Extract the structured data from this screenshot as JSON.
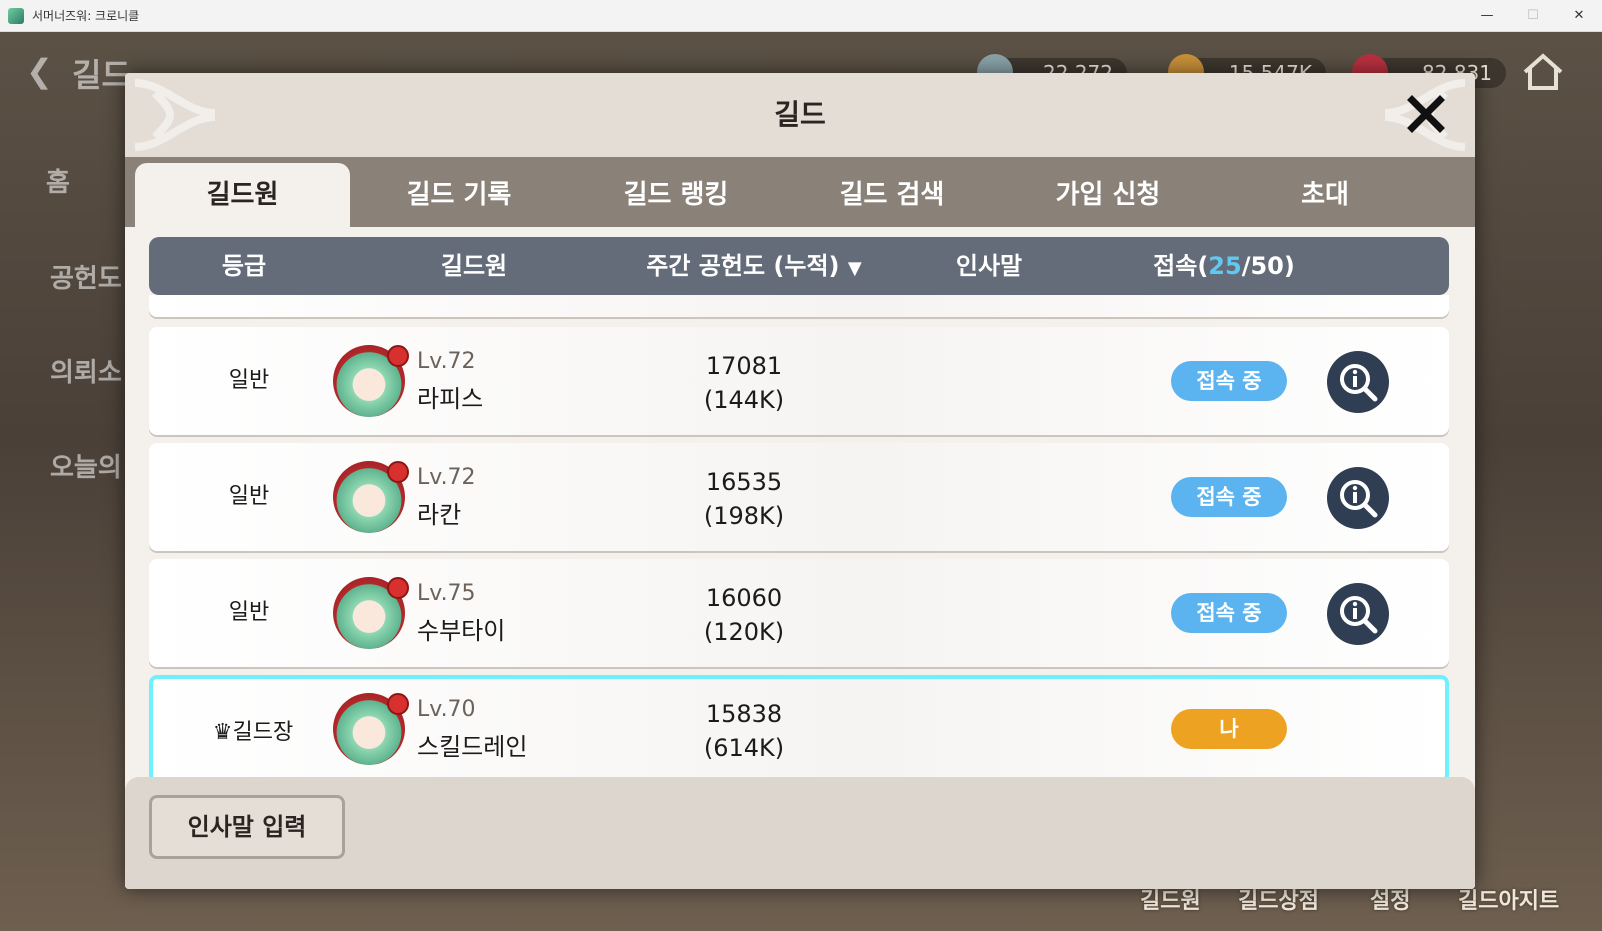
{
  "window": {
    "title": "서머너즈워: 크로니클"
  },
  "background": {
    "header_title": "길드",
    "side_items": [
      "홈",
      "공헌도",
      "의뢰소",
      "오늘의"
    ],
    "currencies": [
      "22,272",
      "15,547K",
      "82,831"
    ],
    "bottom_menu": [
      "길드원",
      "길드상점",
      "설정",
      "길드아지트"
    ]
  },
  "dialog": {
    "title": "길드",
    "tabs": [
      "길드원",
      "길드 기록",
      "길드 랭킹",
      "길드 검색",
      "가입 신청",
      "초대"
    ],
    "active_tab": 0,
    "columns": {
      "grade": "등급",
      "member": "길드원",
      "contribution": "주간 공헌도 (누적)",
      "greeting": "인사말",
      "online_prefix": "접속(",
      "online_count": "25",
      "online_suffix": "/50)"
    },
    "members": [
      {
        "grade": "일반",
        "level": "Lv.72",
        "name": "라피스",
        "weekly": "17081",
        "total": "(144K)",
        "status": "접속 중"
      },
      {
        "grade": "일반",
        "level": "Lv.72",
        "name": "라칸",
        "weekly": "16535",
        "total": "(198K)",
        "status": "접속 중"
      },
      {
        "grade": "일반",
        "level": "Lv.75",
        "name": "수부타이",
        "weekly": "16060",
        "total": "(120K)",
        "status": "접속 중"
      },
      {
        "grade": "길드장",
        "level": "Lv.70",
        "name": "스킬드레인",
        "weekly": "15838",
        "total": "(614K)",
        "status": "나"
      }
    ],
    "footer": {
      "greeting_button": "인사말 입력"
    }
  },
  "colors": {
    "accent_online": "#5bb4ef",
    "accent_me": "#eda321",
    "highlight_border": "#6ff0ff",
    "header_bar": "#646c7a"
  }
}
